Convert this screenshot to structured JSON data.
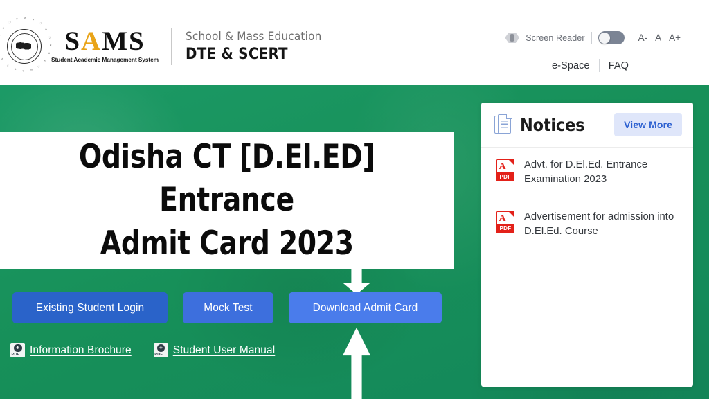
{
  "header": {
    "emblem_icon": "odisha-state-emblem-icon",
    "logo": {
      "part1": "S",
      "accent": "A",
      "part2": "MS",
      "subtitle": "Student Academic Management System"
    },
    "department": {
      "line1": "School & Mass Education",
      "line2": "DTE & SCERT"
    },
    "accessibility": {
      "screen_reader_icon": "screen-reader-icon",
      "screen_reader_label": "Screen Reader",
      "toggle_state": "off",
      "font_decrease": "A-",
      "font_normal": "A",
      "font_increase": "A+"
    },
    "nav": {
      "espace": "e-Space",
      "faq": "FAQ"
    }
  },
  "hero": {
    "headline_line1": "Odisha CT [D.El.ED] Entrance",
    "headline_line2": "Admit Card 2023",
    "buttons": [
      {
        "label": "Existing Student Login",
        "color": "#2a63c9"
      },
      {
        "label": "Mock Test",
        "color": "#3d6fdd"
      },
      {
        "label": "Download Admit Card",
        "color": "#4a7ceb"
      }
    ],
    "links": [
      {
        "label": "Information Brochure",
        "icon": "pdf-download-icon"
      },
      {
        "label": "Student User Manual",
        "icon": "pdf-download-icon"
      }
    ],
    "annotations": {
      "arrow_down_icon": "arrow-down-icon",
      "arrow_up_icon": "arrow-up-icon"
    },
    "background_color": "#179059"
  },
  "notices": {
    "doc_icon": "document-stack-icon",
    "title": "Notices",
    "view_more_label": "View More",
    "view_more_color": "#2b5fd0",
    "items": [
      {
        "icon": "pdf-file-icon",
        "text": "Advt. for D.El.Ed. Entrance Examination 2023"
      },
      {
        "icon": "pdf-file-icon",
        "text": "Advertisement for admission into D.El.Ed. Course"
      }
    ]
  }
}
